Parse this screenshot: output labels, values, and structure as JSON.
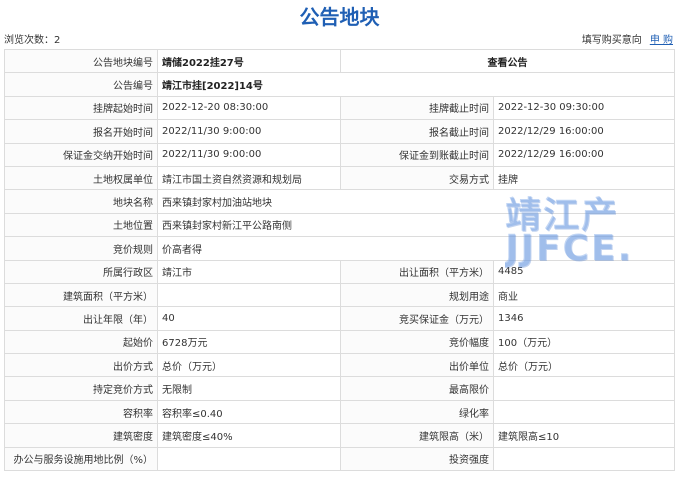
{
  "page": {
    "title": "公告地块"
  },
  "info": {
    "views": "浏览次数：2",
    "fill_intent": "填写购买意向",
    "apply": "申 购"
  },
  "header": {
    "parcel_no_label": "公告地块编号",
    "parcel_no": "靖储2022挂27号",
    "view_notice": "查看公告"
  },
  "rows": {
    "notice_no_label": "公告编号",
    "notice_no": "靖江市挂[2022]14号",
    "listing_start_label": "挂牌起始时间",
    "listing_start": "2022-12-20 08:30:00",
    "listing_end_label": "挂牌截止时间",
    "listing_end": "2022-12-30 09:30:00",
    "signup_start_label": "报名开始时间",
    "signup_start": "2022/11/30 9:00:00",
    "signup_end_label": "报名截止时间",
    "signup_end": "2022/12/29 16:00:00",
    "deposit_start_label": "保证金交纳开始时间",
    "deposit_start": "2022/11/30 9:00:00",
    "deposit_end_label": "保证金到账截止时间",
    "deposit_end": "2022/12/29 16:00:00",
    "owner_label": "土地权属单位",
    "owner": "靖江市国土资自然资源和规划局",
    "trade_mode_label": "交易方式",
    "trade_mode": "挂牌",
    "parcel_name_label": "地块名称",
    "parcel_name": "西来镇封家村加油站地块",
    "location_label": "土地位置",
    "location": "西来镇封家村新江平公路南侧",
    "bid_rule_label": "竞价规则",
    "bid_rule": "价高者得",
    "district_label": "所属行政区",
    "district": "靖江市",
    "transfer_area_label": "出让面积（平方米）",
    "transfer_area": "4485",
    "build_area_label": "建筑面积（平方米）",
    "build_area": "",
    "use_label": "规划用途",
    "use": "商业",
    "years_label": "出让年限（年）",
    "years": "40",
    "bid_deposit_label": "竞买保证金（万元）",
    "bid_deposit": "1346",
    "start_price_label": "起始价",
    "start_price": "6728万元",
    "increment_label": "竞价幅度",
    "increment": "100（万元）",
    "price_mode_label": "出价方式",
    "price_mode": "总价（万元）",
    "price_unit_label": "出价单位",
    "price_unit": "总价（万元）",
    "special_label": "持定竞价方式",
    "special": "无限制",
    "max_price_label": "最高限价",
    "max_price": "",
    "far_label": "容积率",
    "far": "容积率≤0.40",
    "green_label": "绿化率",
    "green": "",
    "density_label": "建筑密度",
    "density": "建筑密度≤40%",
    "height_label": "建筑限高（米）",
    "height": "建筑限高≤10",
    "office_ratio_label": "办公与服务设施用地比例（%）",
    "office_ratio": "",
    "invest_label": "投资强度",
    "invest": ""
  },
  "watermark": {
    "line1": "靖江产",
    "line2": "JJFCE."
  }
}
